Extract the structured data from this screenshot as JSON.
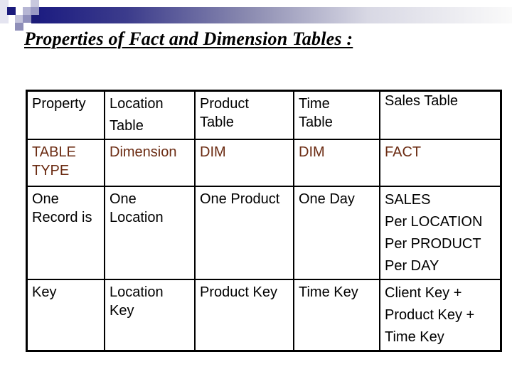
{
  "slide": {
    "title": "Properties of Fact and Dimension Tables :"
  },
  "table": {
    "header": [
      {
        "lines": [
          "Property"
        ]
      },
      {
        "lines": [
          "Location",
          "Table"
        ]
      },
      {
        "lines": [
          "Product",
          "Table"
        ]
      },
      {
        "lines": [
          "Time",
          "Table"
        ]
      },
      {
        "lines": [
          "Sales Table"
        ]
      }
    ],
    "rows": [
      {
        "label": [
          "TABLE",
          "TYPE"
        ],
        "cells": [
          [
            "Dimension"
          ],
          [
            "DIM"
          ],
          [
            "DIM"
          ],
          [
            "FACT"
          ]
        ]
      },
      {
        "label": [
          "One",
          "Record is"
        ],
        "cells": [
          [
            "One",
            "Location"
          ],
          [
            "One Product"
          ],
          [
            "One Day"
          ],
          [
            "SALES",
            "Per LOCATION",
            "Per PRODUCT",
            "Per DAY"
          ]
        ]
      },
      {
        "label": [
          "Key"
        ],
        "cells": [
          [
            "Location",
            "Key"
          ],
          [
            "Product Key"
          ],
          [
            "Time Key"
          ],
          [
            "Client Key +",
            "Product Key +",
            "Time Key"
          ]
        ]
      }
    ]
  },
  "colors": {
    "text": "#000000",
    "table_type_text": "#6b2b12",
    "header_band_dark": "#1a1a80",
    "border": "#000000"
  }
}
